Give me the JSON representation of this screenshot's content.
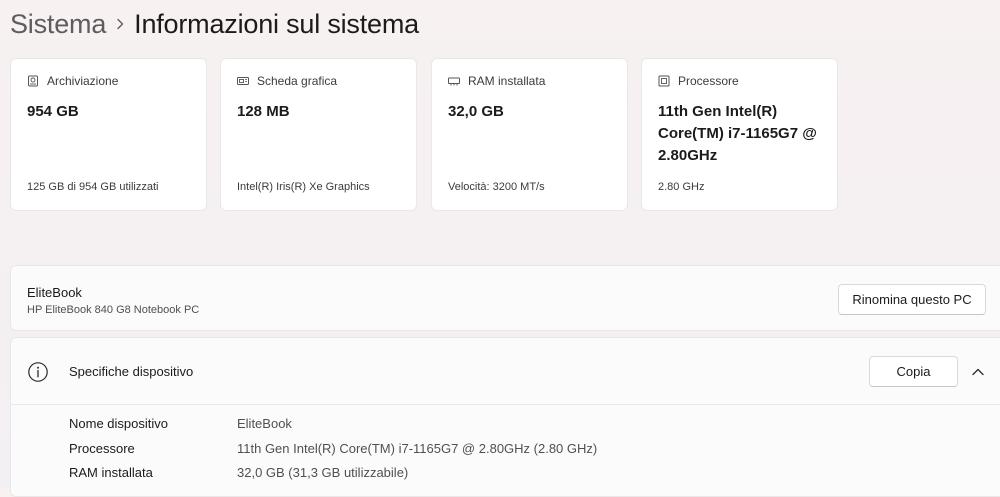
{
  "header": {
    "parent": "Sistema",
    "current": "Informazioni sul sistema"
  },
  "cards": [
    {
      "icon": "storage-icon",
      "label": "Archiviazione",
      "value": "954 GB",
      "detail": "125 GB di 954 GB utilizzati"
    },
    {
      "icon": "graphics-card-icon",
      "label": "Scheda grafica",
      "value": "128 MB",
      "detail": "Intel(R) Iris(R) Xe Graphics"
    },
    {
      "icon": "ram-icon",
      "label": "RAM installata",
      "value": "32,0 GB",
      "detail": "Velocità: 3200 MT/s"
    },
    {
      "icon": "processor-icon",
      "label": "Processore",
      "value": "11th Gen Intel(R) Core(TM) i7-1165G7 @ 2.80GHz",
      "detail": "2.80 GHz"
    }
  ],
  "device": {
    "name": "EliteBook",
    "model": "HP EliteBook 840 G8 Notebook PC",
    "rename_label": "Rinomina questo PC"
  },
  "specs": {
    "title": "Specifiche dispositivo",
    "copy_label": "Copia",
    "rows": [
      {
        "label": "Nome dispositivo",
        "value": "EliteBook"
      },
      {
        "label": "Processore",
        "value": "11th Gen Intel(R) Core(TM) i7-1165G7 @ 2.80GHz (2.80 GHz)"
      },
      {
        "label": "RAM installata",
        "value": "32,0 GB (31,3 GB utilizzabile)"
      }
    ]
  }
}
